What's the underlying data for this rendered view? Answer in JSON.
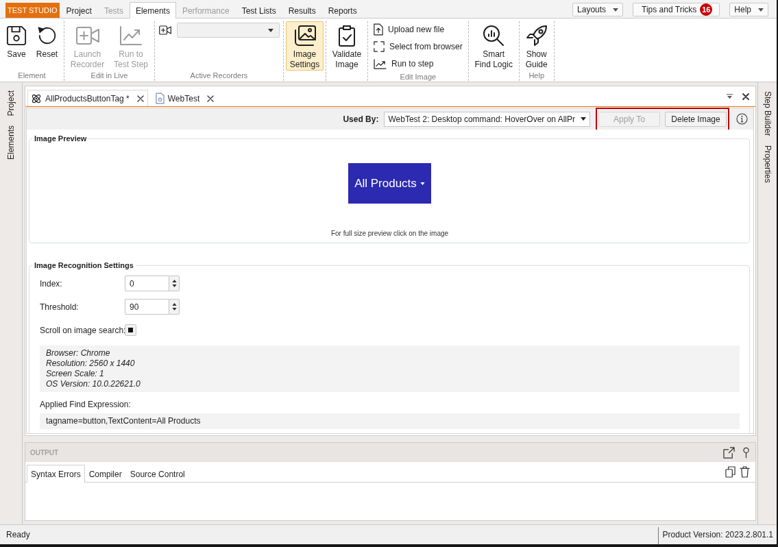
{
  "app": {
    "brand": "TEST STUDIO"
  },
  "menu_tabs": [
    {
      "label": "Project",
      "selected": false,
      "disabled": false
    },
    {
      "label": "Tests",
      "selected": false,
      "disabled": true
    },
    {
      "label": "Elements",
      "selected": true,
      "disabled": false
    },
    {
      "label": "Performance",
      "selected": false,
      "disabled": true
    },
    {
      "label": "Test Lists",
      "selected": false,
      "disabled": false
    },
    {
      "label": "Results",
      "selected": false,
      "disabled": false
    },
    {
      "label": "Reports",
      "selected": false,
      "disabled": false
    }
  ],
  "top_controls": [
    {
      "kind": "dropdown",
      "label": "Layouts"
    },
    {
      "kind": "button",
      "label": "Tips and Tricks",
      "badge": "16"
    },
    {
      "kind": "dropdown",
      "label": "Help"
    }
  ],
  "ribbon": {
    "groups": [
      {
        "label": "Element",
        "items": [
          {
            "kind": "large",
            "label": "Save",
            "disabled": false,
            "selected": false
          },
          {
            "kind": "large",
            "label": "Reset",
            "disabled": false,
            "selected": false
          }
        ]
      },
      {
        "label": "Edit in Live",
        "items": [
          {
            "kind": "large",
            "label": "Launch Recorder",
            "disabled": true,
            "selected": false
          },
          {
            "kind": "large",
            "label": "Run to Test Step",
            "disabled": true,
            "selected": false
          }
        ]
      },
      {
        "label": "Active Recorders",
        "items": [
          {
            "kind": "recorder_select",
            "disabled": false,
            "selected": false
          }
        ]
      },
      {
        "items": [
          {
            "kind": "large",
            "label": "Image Settings",
            "disabled": false,
            "selected": true
          }
        ]
      },
      {
        "items": [
          {
            "kind": "large",
            "label": "Validate Image",
            "disabled": false,
            "selected": false
          }
        ]
      },
      {
        "label": "Edit Image",
        "items": [
          {
            "kind": "small",
            "label": "Upload new file",
            "disabled": false,
            "selected": false
          },
          {
            "kind": "small",
            "label": "Select from browser",
            "disabled": false,
            "selected": false
          },
          {
            "kind": "small",
            "label": "Run to step",
            "disabled": false,
            "selected": false
          }
        ]
      },
      {
        "items": [
          {
            "kind": "large",
            "label": "Smart Find Logic",
            "disabled": false,
            "selected": false
          }
        ]
      },
      {
        "label": "Help",
        "items": [
          {
            "kind": "large",
            "label": "Show Guide",
            "disabled": false,
            "selected": false
          }
        ]
      }
    ]
  },
  "side_left": [
    {
      "label": "Project",
      "selected": false
    },
    {
      "label": "Elements",
      "selected": false
    }
  ],
  "side_right": [
    {
      "label": "Step Builder",
      "selected": false
    },
    {
      "label": "Properties",
      "selected": false
    }
  ],
  "documents": [
    {
      "label": "AllProductsButtonTag *",
      "selected": true
    },
    {
      "label": "WebTest",
      "selected": false
    }
  ],
  "image_editor": {
    "used_by": {
      "label": "Used By:",
      "value": "WebTest 2: Desktop command: HoverOver on AllPr"
    },
    "actions": {
      "highlighted": true,
      "buttons": [
        {
          "label": "Apply To",
          "disabled": true
        },
        {
          "label": "Delete Image",
          "disabled": false
        }
      ]
    },
    "preview": {
      "title": "Image Preview",
      "image_text": "All Products",
      "caption": "For full size preview click on the image"
    },
    "recognition": {
      "title": "Image Recognition Settings",
      "fields": [
        {
          "kind": "spinner",
          "label": "Index:",
          "value": "0"
        },
        {
          "kind": "spinner",
          "label": "Threshold:",
          "value": "90"
        },
        {
          "kind": "checkbox",
          "label": "Scroll on image search:",
          "checked": true
        }
      ],
      "environment": [
        "Browser: Chrome",
        "Resolution: 2560 x 1440",
        "Screen Scale: 1",
        "OS Version: 10.0.22621.0"
      ],
      "find_expression": {
        "label": "Applied Find Expression:",
        "value": "tagname=button,TextContent=All Products"
      }
    }
  },
  "output": {
    "title": "OUTPUT",
    "tabs": [
      {
        "label": "Syntax Errors",
        "selected": true
      },
      {
        "label": "Compiler",
        "selected": false
      },
      {
        "label": "Source Control",
        "selected": false
      }
    ]
  },
  "status_bar": {
    "status": "Ready",
    "version": "Product Version: 2023.2.801.1"
  }
}
